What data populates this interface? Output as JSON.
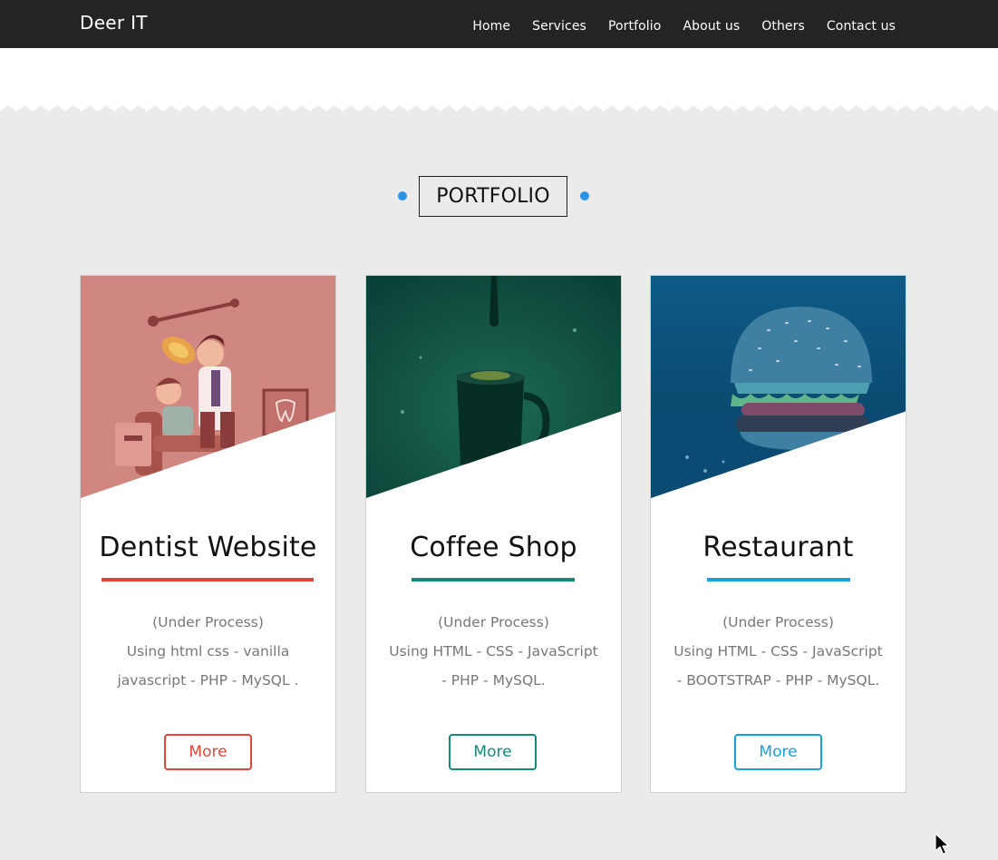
{
  "navbar": {
    "brand": "Deer IT",
    "items": [
      {
        "label": "Home"
      },
      {
        "label": "Services"
      },
      {
        "label": "Portfolio"
      },
      {
        "label": "About us"
      },
      {
        "label": "Others"
      },
      {
        "label": "Contact us"
      }
    ]
  },
  "section": {
    "title": "PORTFOLIO",
    "dot_color": "#2a93e8"
  },
  "cards": [
    {
      "title": "Dentist Website",
      "status": "(Under Process)",
      "desc_line1": "Using html css - vanilla",
      "desc_line2": "javascript - PHP - MySQL .",
      "button": "More",
      "accent": "#e0463c",
      "image": "dentist-illustration"
    },
    {
      "title": "Coffee Shop",
      "status": "(Under Process)",
      "desc_line1": "Using HTML - CSS - JavaScript",
      "desc_line2": "- PHP - MySQL.",
      "button": "More",
      "accent": "#14897a",
      "image": "coffee-cup-photo"
    },
    {
      "title": "Restaurant",
      "status": "(Under Process)",
      "desc_line1": "Using HTML - CSS - JavaScript",
      "desc_line2": "- BOOTSTRAP - PHP - MySQL.",
      "button": "More",
      "accent": "#1a9fd6",
      "image": "burger-photo"
    }
  ]
}
